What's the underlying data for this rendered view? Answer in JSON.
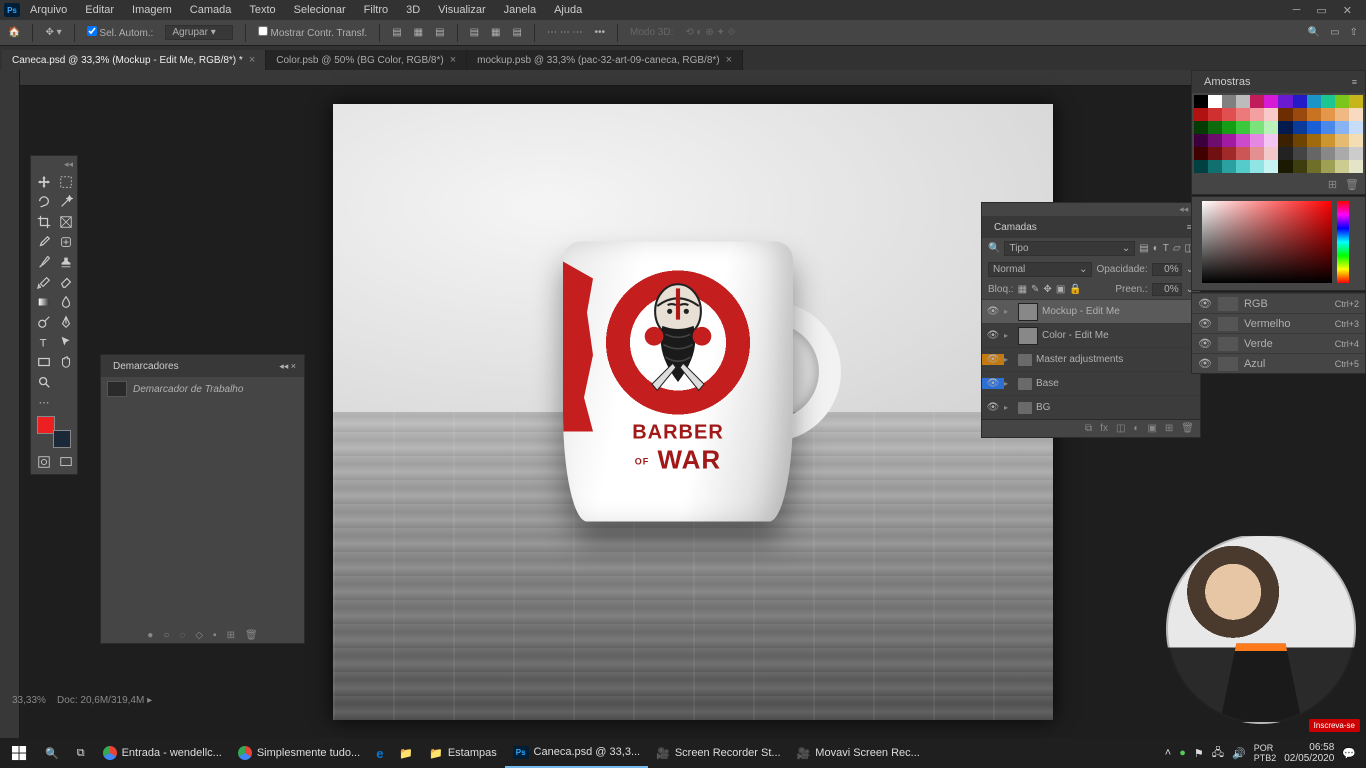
{
  "menu": [
    "Arquivo",
    "Editar",
    "Imagem",
    "Camada",
    "Texto",
    "Selecionar",
    "Filtro",
    "3D",
    "Visualizar",
    "Janela",
    "Ajuda"
  ],
  "options": {
    "auto_select": "Sel. Autom.:",
    "group": "Agrupar",
    "show_transform": "Mostrar Contr. Transf.",
    "mode3d": "Modo 3D:"
  },
  "tabs": [
    {
      "label": "Caneca.psd @ 33,3% (Mockup - Edit Me, RGB/8*) *",
      "active": true
    },
    {
      "label": "Color.psb @ 50% (BG Color, RGB/8*)",
      "active": false
    },
    {
      "label": "mockup.psb @ 33,3% (pac-32-art-09-caneca, RGB/8*)",
      "active": false
    }
  ],
  "paths_panel": {
    "title": "Demarcadores",
    "work_path": "Demarcador de Trabalho"
  },
  "layers_panel": {
    "title": "Camadas",
    "kind_label": "Tipo",
    "blend": "Normal",
    "opacity_label": "Opacidade:",
    "opacity_val": "0%",
    "lock_label": "Bloq.:",
    "fill_label": "Preen.:",
    "fill_val": "0%",
    "layers": [
      {
        "name": "Mockup - Edit Me",
        "type": "smart",
        "selected": true
      },
      {
        "name": "Color - Edit Me",
        "type": "smart",
        "selected": false
      },
      {
        "name": "Master adjustments",
        "type": "folder",
        "color": "#c47a12",
        "selected": false
      },
      {
        "name": "Base",
        "type": "folder",
        "color": "#2e6fd4",
        "selected": false
      },
      {
        "name": "BG",
        "type": "folder",
        "selected": false
      }
    ]
  },
  "swatches_panel": {
    "title": "Amostras"
  },
  "channels": [
    {
      "name": "RGB",
      "shortcut": "Ctrl+2"
    },
    {
      "name": "Vermelho",
      "shortcut": "Ctrl+3"
    },
    {
      "name": "Verde",
      "shortcut": "Ctrl+4"
    },
    {
      "name": "Azul",
      "shortcut": "Ctrl+5"
    }
  ],
  "artwork": {
    "line1": "BARBER",
    "of": "OF",
    "line2": "WAR"
  },
  "status": {
    "zoom": "33,33%",
    "doc": "Doc: 20,6M/319,4M"
  },
  "taskbar": {
    "items": [
      {
        "label": "Entrada - wendellc...",
        "ico": "chrome"
      },
      {
        "label": "Simplesmente tudo...",
        "ico": "chrome"
      },
      {
        "label": "",
        "ico": "edge"
      },
      {
        "label": "",
        "ico": "explorer"
      },
      {
        "label": "Estampas",
        "ico": "folder"
      },
      {
        "label": "Caneca.psd @ 33,3...",
        "ico": "ps",
        "active": true
      },
      {
        "label": "Screen Recorder St...",
        "ico": "rec"
      },
      {
        "label": "Movavi Screen Rec...",
        "ico": "rec"
      }
    ],
    "time": "06:58",
    "date": "02/05/2020"
  },
  "subscribe": "Inscreva-se",
  "colors": {
    "fg": "#ec2020",
    "bg": "#1a2838"
  },
  "swatches": [
    "#000",
    "#fff",
    "#808080",
    "#bcbcbc",
    "#c01b5b",
    "#d61bd6",
    "#6a1bd1",
    "#221bc6",
    "#1b94c6",
    "#1bc692",
    "#7bc61b",
    "#c6b61b",
    "#b01111",
    "#d03030",
    "#e05050",
    "#ed7a7a",
    "#f4a0a0",
    "#f9c8c8",
    "#6e2d00",
    "#9a4a0d",
    "#c87321",
    "#e4974a",
    "#f0b983",
    "#f7dac0",
    "#063b06",
    "#0d6b0d",
    "#169d16",
    "#3cc83c",
    "#7ce27c",
    "#b8f2b8",
    "#031a4f",
    "#0a3a9a",
    "#1a5fd6",
    "#4a89ea",
    "#88b3f2",
    "#c6dcf9",
    "#3b003b",
    "#6f0d6f",
    "#a11aa1",
    "#cc4acc",
    "#e488e4",
    "#f3c6f3",
    "#3b2100",
    "#6f4400",
    "#a16a0d",
    "#cc9530",
    "#e4bb70",
    "#f3ddb5",
    "#400000",
    "#701010",
    "#a02a2a",
    "#cc5555",
    "#e49090",
    "#f3c8c8",
    "#222",
    "#444",
    "#666",
    "#888",
    "#aaa",
    "#ccc",
    "#004040",
    "#106f6f",
    "#2aa0a0",
    "#55cccc",
    "#90e4e4",
    "#c8f3f3",
    "#1a1a00",
    "#3d3d10",
    "#6f6f2a",
    "#a0a055",
    "#cccc90",
    "#e4e4c8"
  ]
}
